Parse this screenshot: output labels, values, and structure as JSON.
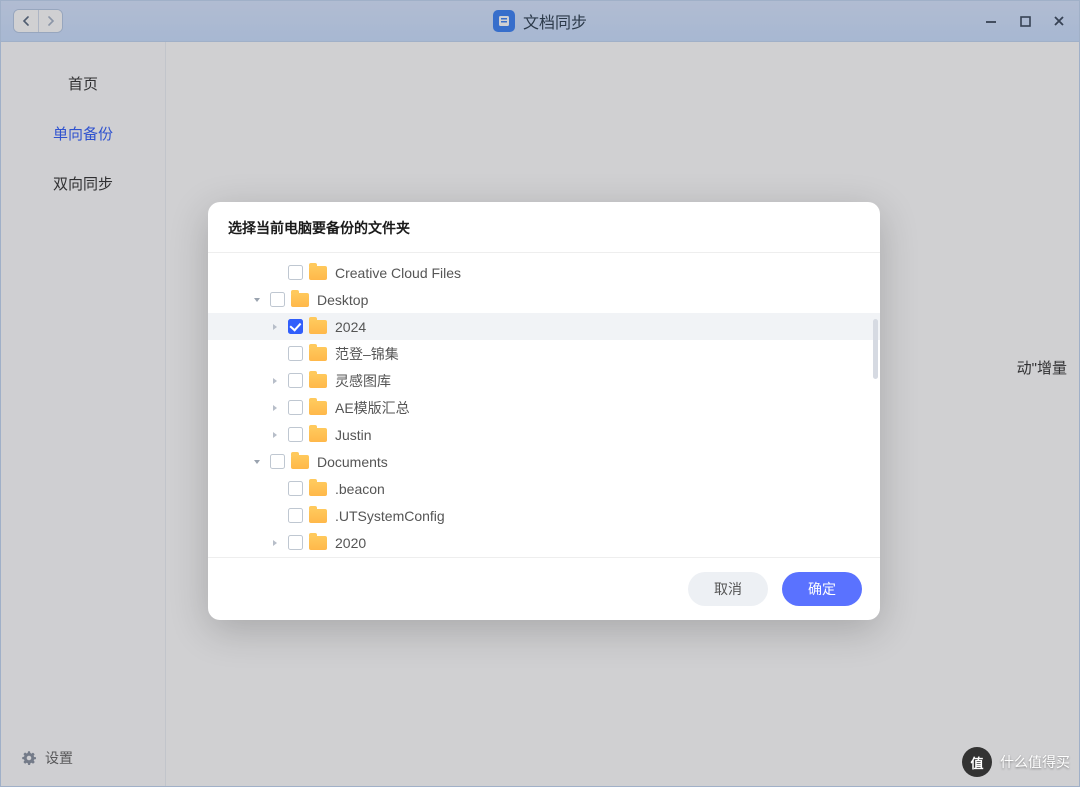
{
  "titlebar": {
    "title": "文档同步"
  },
  "windowControls": {
    "minimize": "–",
    "maximize": "□",
    "close": "×"
  },
  "sidebar": {
    "items": [
      {
        "label": "首页",
        "active": false
      },
      {
        "label": "单向备份",
        "active": true
      },
      {
        "label": "双向同步",
        "active": false
      }
    ],
    "settings": "设置"
  },
  "background": {
    "partialText": "动\"增量"
  },
  "dialog": {
    "title": "选择当前电脑要备份的文件夹",
    "cancel": "取消",
    "confirm": "确定",
    "tree": [
      {
        "level": 2,
        "expander": "none",
        "checked": false,
        "label": "Creative Cloud Files",
        "selected": false
      },
      {
        "level": 1,
        "expander": "open",
        "checked": false,
        "label": "Desktop",
        "selected": false
      },
      {
        "level": 2,
        "expander": "closed",
        "checked": true,
        "label": "2024",
        "selected": true
      },
      {
        "level": 2,
        "expander": "none",
        "checked": false,
        "label": "范登–锦集",
        "selected": false
      },
      {
        "level": 2,
        "expander": "closed",
        "checked": false,
        "label": "灵感图库",
        "selected": false
      },
      {
        "level": 2,
        "expander": "closed",
        "checked": false,
        "label": "AE模版汇总",
        "selected": false
      },
      {
        "level": 2,
        "expander": "closed",
        "checked": false,
        "label": "Justin",
        "selected": false
      },
      {
        "level": 1,
        "expander": "open",
        "checked": false,
        "label": "Documents",
        "selected": false
      },
      {
        "level": 2,
        "expander": "none",
        "checked": false,
        "label": ".beacon",
        "selected": false
      },
      {
        "level": 2,
        "expander": "none",
        "checked": false,
        "label": ".UTSystemConfig",
        "selected": false
      },
      {
        "level": 2,
        "expander": "closed",
        "checked": false,
        "label": "2020",
        "selected": false
      }
    ]
  },
  "watermark": {
    "badge": "值",
    "text": "什么值得买"
  }
}
